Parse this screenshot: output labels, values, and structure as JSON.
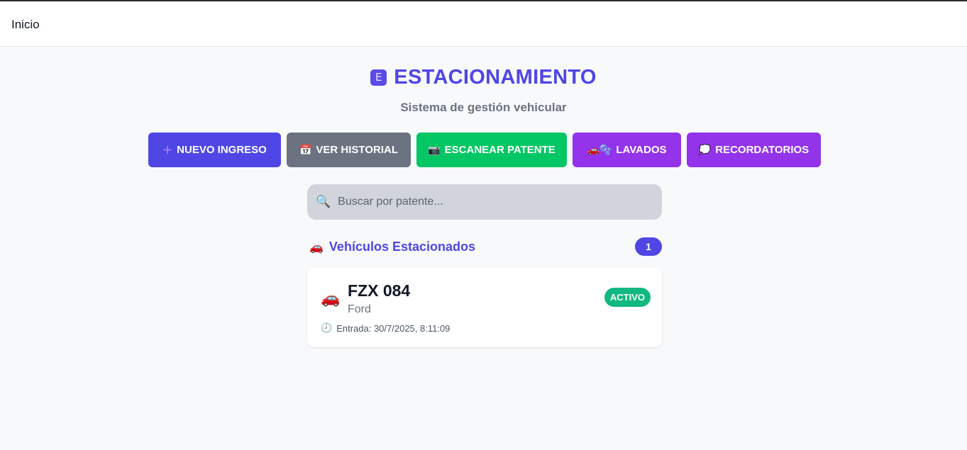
{
  "topbar": {
    "title": "Inicio"
  },
  "header": {
    "logo_glyph": "E",
    "title": "ESTACIONAMIENTO",
    "subtitle": "Sistema de gestión vehicular"
  },
  "actions": [
    {
      "label": "NUEVO INGRESO",
      "icon": "plus-icon",
      "glyph": "＋",
      "color": "#4f46e5"
    },
    {
      "label": "VER HISTORIAL",
      "icon": "calendar-icon",
      "glyph": "📅",
      "color": "#6b7280"
    },
    {
      "label": "ESCANEAR PATENTE",
      "icon": "camera-icon",
      "glyph": "📷",
      "color": "#03c764"
    },
    {
      "label": "LAVADOS",
      "icon": "car-bubbles-icon",
      "glyph": "🚗🫧",
      "color": "#9333ea"
    },
    {
      "label": "RECORDATORIOS",
      "icon": "speech-bubble-icon",
      "glyph": "💭",
      "color": "#9333ea"
    }
  ],
  "search": {
    "icon": "search-icon",
    "placeholder": "Buscar por patente...",
    "value": ""
  },
  "parked": {
    "icon": "car-icon",
    "title": "Vehículos Estacionados",
    "count": "1",
    "vehicles": [
      {
        "plate": "FZX 084",
        "brand": "Ford",
        "status": "ACTIVO",
        "entry": "Entrada: 30/7/2025, 8:11:09"
      }
    ]
  },
  "colors": {
    "accent": "#4f46e5",
    "success": "#03c764",
    "status_active": "#10b981",
    "purple": "#9333ea",
    "gray": "#6b7280"
  }
}
